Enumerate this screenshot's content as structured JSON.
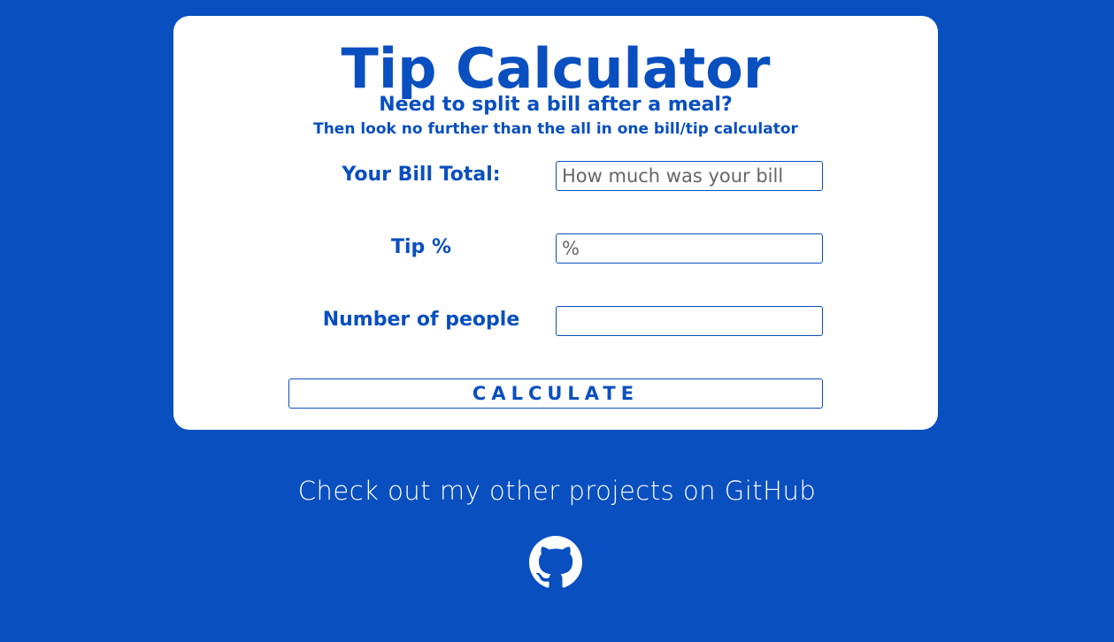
{
  "card": {
    "title": "Tip Calculator",
    "subtitle": "Need to split a bill after a meal?",
    "tagline": "Then look no further than the all in one bill/tip calculator"
  },
  "form": {
    "bill": {
      "label": "Your Bill Total:",
      "placeholder": "How much was your bill",
      "value": ""
    },
    "tip": {
      "label": "Tip %",
      "placeholder": "%",
      "value": ""
    },
    "people": {
      "label": "Number of people",
      "placeholder": "",
      "value": ""
    },
    "calculate_label": "CALCULATE"
  },
  "footer": {
    "text": "Check out my other projects on GitHub",
    "icon": "github-icon"
  },
  "colors": {
    "background": "#0a4fbf",
    "card": "#ffffff",
    "accent": "#0a4fbf"
  }
}
